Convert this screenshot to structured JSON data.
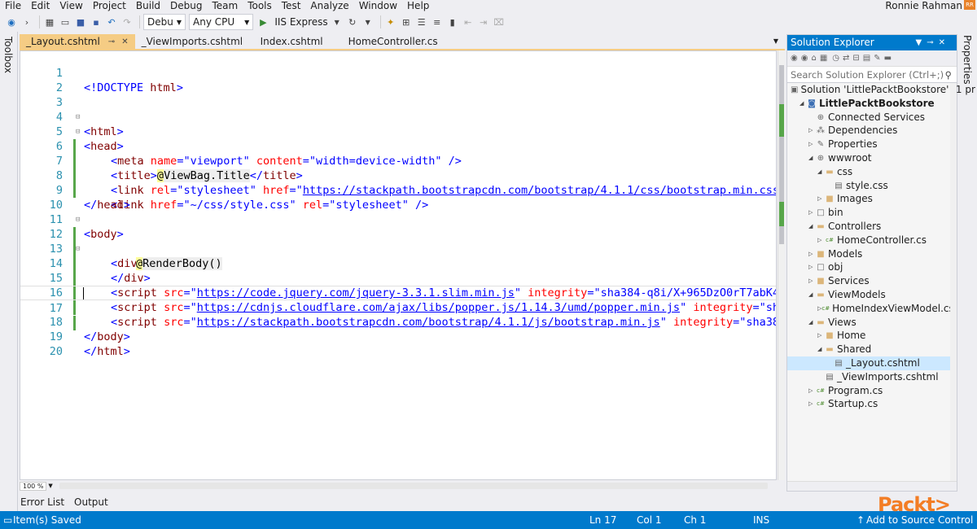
{
  "menu": [
    "File",
    "Edit",
    "View",
    "Project",
    "Build",
    "Debug",
    "Team",
    "Tools",
    "Test",
    "Analyze",
    "Window",
    "Help"
  ],
  "user": "Ronnie Rahman",
  "user_badge": "RR",
  "toolbar": {
    "config": "Debu",
    "platform": "Any CPU",
    "run_target": "IIS Express"
  },
  "side": {
    "toolbox": "Toolbox",
    "properties": "Properties"
  },
  "tabs": [
    {
      "label": "_Layout.cshtml",
      "active": true
    },
    {
      "label": "_ViewImports.cshtml",
      "active": false
    },
    {
      "label": "Index.cshtml",
      "active": false
    },
    {
      "label": "HomeController.cs",
      "active": false
    }
  ],
  "code_lines": [
    {
      "n": "1"
    },
    {
      "n": "2"
    },
    {
      "n": "3"
    },
    {
      "n": "4"
    },
    {
      "n": "5"
    },
    {
      "n": "6"
    },
    {
      "n": "7"
    },
    {
      "n": "8"
    },
    {
      "n": "9"
    },
    {
      "n": "10"
    },
    {
      "n": "11"
    },
    {
      "n": "12"
    },
    {
      "n": "13"
    },
    {
      "n": "14"
    },
    {
      "n": "15"
    },
    {
      "n": "16"
    },
    {
      "n": "17"
    },
    {
      "n": "18"
    },
    {
      "n": "19"
    },
    {
      "n": "20"
    }
  ],
  "code": {
    "l1_doctype": "<!DOCTYPE",
    "l1_html": "html",
    "l1_close": ">",
    "lt": "<",
    "gt": ">",
    "lt_slash": "</",
    "self_close": " />",
    "eq": "=",
    "tag_html": "html",
    "tag_head": "head",
    "tag_meta": "meta",
    "tag_title": "title",
    "tag_link": "link",
    "tag_body": "body",
    "tag_div": "div",
    "tag_script": "script",
    "attr_name": "name",
    "attr_content": "content",
    "attr_rel": "rel",
    "attr_href": "href",
    "attr_src": "src",
    "attr_integrity": "integrity",
    "v_viewport": "\"viewport\"",
    "v_content": "\"width=device-width\"",
    "v_stylesheet": "\"stylesheet\"",
    "q": "\"",
    "v_bootstrap_css": "https://stackpath.bootstrapcdn.com/bootstrap/4.1.1/css/bootstrap.min.css",
    "v_site_css": "\"~/css/style.css\"",
    "razor_at": "@",
    "razor_title": "ViewBag.Title",
    "razor_body": "RenderBody()",
    "v_jquery": "https://code.jquery.com/jquery-3.3.1.slim.min.js",
    "v_jquery_int": "\"sha384-q8i/X+965DzO0rT7abK4",
    "v_popper": "https://cdnjs.cloudflare.com/ajax/libs/popper.js/1.14.3/umd/popper.min.js",
    "v_popper_int": "\"sh",
    "v_bs_js": "https://stackpath.bootstrapcdn.com/bootstrap/4.1.1/js/bootstrap.min.js",
    "v_bs_int": "\"sha38"
  },
  "editor_bottom": {
    "zoom": "100 %"
  },
  "bottom_tabs": [
    "Error List",
    "Output"
  ],
  "solution_explorer": {
    "title": "Solution Explorer",
    "search_placeholder": "Search Solution Explorer (Ctrl+;)",
    "items": [
      {
        "label": "Solution 'LittlePacktBookstore' (1 pr",
        "indent": 0,
        "icon": "solution-icon",
        "tri": "",
        "bold": false
      },
      {
        "label": "LittlePacktBookstore",
        "indent": 1,
        "icon": "web-project-icon",
        "tri": "◢",
        "bold": true
      },
      {
        "label": "Connected Services",
        "indent": 2,
        "icon": "connected-services-icon",
        "tri": "",
        "bold": false
      },
      {
        "label": "Dependencies",
        "indent": 2,
        "icon": "dependencies-icon",
        "tri": "▷",
        "bold": false
      },
      {
        "label": "Properties",
        "indent": 2,
        "icon": "wrench-icon",
        "tri": "▷",
        "bold": false
      },
      {
        "label": "wwwroot",
        "indent": 2,
        "icon": "globe-icon",
        "tri": "◢",
        "bold": false
      },
      {
        "label": "css",
        "indent": 3,
        "icon": "folder-open-icon",
        "tri": "◢",
        "bold": false
      },
      {
        "label": "style.css",
        "indent": 4,
        "icon": "css-file-icon",
        "tri": "",
        "bold": false
      },
      {
        "label": "Images",
        "indent": 3,
        "icon": "folder-icon",
        "tri": "▷",
        "bold": false
      },
      {
        "label": "bin",
        "indent": 2,
        "icon": "hidden-folder-icon",
        "tri": "▷",
        "bold": false
      },
      {
        "label": "Controllers",
        "indent": 2,
        "icon": "folder-open-icon",
        "tri": "◢",
        "bold": false
      },
      {
        "label": "HomeController.cs",
        "indent": 3,
        "icon": "csharp-file-icon",
        "tri": "▷",
        "bold": false
      },
      {
        "label": "Models",
        "indent": 2,
        "icon": "folder-icon",
        "tri": "▷",
        "bold": false
      },
      {
        "label": "obj",
        "indent": 2,
        "icon": "hidden-folder-icon",
        "tri": "▷",
        "bold": false
      },
      {
        "label": "Services",
        "indent": 2,
        "icon": "folder-icon",
        "tri": "▷",
        "bold": false
      },
      {
        "label": "ViewModels",
        "indent": 2,
        "icon": "folder-open-icon",
        "tri": "◢",
        "bold": false
      },
      {
        "label": "HomeIndexViewModel.cs",
        "indent": 3,
        "icon": "csharp-file-icon",
        "tri": "▷",
        "bold": false
      },
      {
        "label": "Views",
        "indent": 2,
        "icon": "folder-open-icon",
        "tri": "◢",
        "bold": false
      },
      {
        "label": "Home",
        "indent": 3,
        "icon": "folder-icon",
        "tri": "▷",
        "bold": false
      },
      {
        "label": "Shared",
        "indent": 3,
        "icon": "folder-open-icon",
        "tri": "◢",
        "bold": false
      },
      {
        "label": "_Layout.cshtml",
        "indent": 4,
        "icon": "razor-file-icon",
        "tri": "",
        "bold": false,
        "selected": true
      },
      {
        "label": "_ViewImports.cshtml",
        "indent": 3,
        "icon": "razor-file-icon",
        "tri": "",
        "bold": false
      },
      {
        "label": "Program.cs",
        "indent": 2,
        "icon": "csharp-file-icon",
        "tri": "▷",
        "bold": false
      },
      {
        "label": "Startup.cs",
        "indent": 2,
        "icon": "csharp-file-icon",
        "tri": "▷",
        "bold": false
      }
    ]
  },
  "status": {
    "message": "Item(s) Saved",
    "ln": "Ln 17",
    "col": "Col 1",
    "ch": "Ch 1",
    "mode": "INS",
    "source_control": "Add to Source Control"
  },
  "watermark": "Packt>",
  "colors": {
    "accent_blue": "#007acc",
    "active_tab": "#f5cc84",
    "line_number": "#2b91af",
    "tag": "#800000",
    "attribute": "#ff0000",
    "value": "#0000ff",
    "packt_orange": "#f37d25"
  }
}
